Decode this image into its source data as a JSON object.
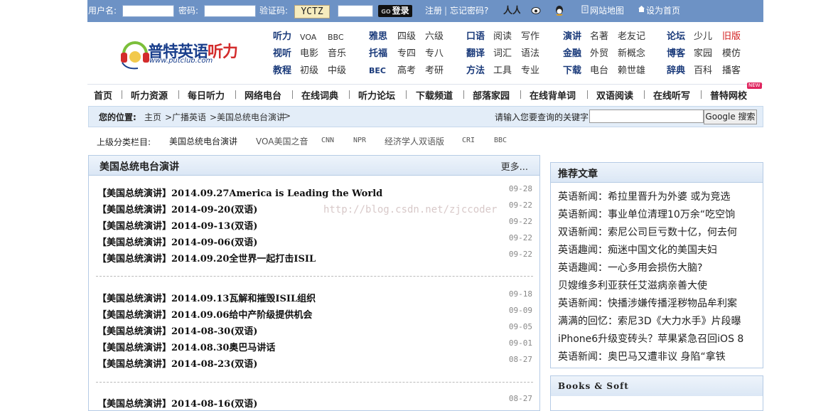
{
  "login": {
    "username_label": "用户名:",
    "password_label": "密码:",
    "captcha_label": "验证码:",
    "captcha_text": "YCTZ",
    "login_button": "登录",
    "login_key": "GO",
    "register": "注册",
    "forgot": "忘记密码?",
    "sitemap": "网站地图",
    "homepage": "设为首页"
  },
  "logo": {
    "name_part1": "普特英语",
    "name_part2": "听力",
    "url": "www.putclub.com"
  },
  "header_nav": [
    [
      "听力",
      "VOA",
      "BBC"
    ],
    [
      "视听",
      "电影",
      "音乐"
    ],
    [
      "教程",
      "初级",
      "中级"
    ],
    [
      "雅思",
      "四级",
      "六级"
    ],
    [
      "托福",
      "专四",
      "专八"
    ],
    [
      "BEC",
      "高考",
      "考研"
    ],
    [
      "口语",
      "阅读",
      "写作"
    ],
    [
      "翻译",
      "词汇",
      "语法"
    ],
    [
      "方法",
      "工具",
      "专业"
    ],
    [
      "演讲",
      "名著",
      "老友记"
    ],
    [
      "金融",
      "外贸",
      "新概念"
    ],
    [
      "下载",
      "电台",
      "赖世雄"
    ],
    [
      "论坛",
      "少儿",
      "旧版"
    ],
    [
      "博客",
      "家园",
      "模仿"
    ],
    [
      "辞典",
      "百科",
      "播客"
    ]
  ],
  "menu": [
    "首页",
    "听力资源",
    "每日听力",
    "网络电台",
    "在线词典",
    "听力论坛",
    "下载频道",
    "部落家园",
    "在线背单词",
    "双语阅读",
    "在线听写",
    "普特网校"
  ],
  "menu_badge": "NEW",
  "location": {
    "label": "您的位置:",
    "crumbs": [
      "主页",
      ">广播英语",
      ">美国总统电台演讲",
      ">"
    ],
    "search_prompt": "请输入您要查询的关键字",
    "search_button": "Google 搜索"
  },
  "categories": {
    "label": "上级分类栏目:",
    "items": [
      "美国总统电台演讲",
      "VOA美国之音",
      "CNN",
      "NPR",
      "经济学人双语版",
      "CRI",
      "BBC"
    ]
  },
  "list_panel": {
    "title": "美国总统电台演讲",
    "more": "更多...",
    "groups": [
      [
        {
          "title": "【美国总统演讲】2014.09.27America is Leading the World",
          "date": "09-28"
        },
        {
          "title": "【美国总统演讲】2014-09-20(双语)",
          "date": "09-22"
        },
        {
          "title": "【美国总统演讲】2014-09-13(双语)",
          "date": "09-22"
        },
        {
          "title": "【美国总统演讲】2014-09-06(双语)",
          "date": "09-22"
        },
        {
          "title": "【美国总统演讲】2014.09.20全世界一起打击ISIL",
          "date": "09-22"
        }
      ],
      [
        {
          "title": "【美国总统演讲】2014.09.13瓦解和摧毁ISIL组织",
          "date": "09-18"
        },
        {
          "title": "【美国总统演讲】2014.09.06给中产阶级提供机会",
          "date": "09-09"
        },
        {
          "title": "【美国总统演讲】2014-08-30(双语)",
          "date": "09-05"
        },
        {
          "title": "【美国总统演讲】2014.08.30奥巴马讲话",
          "date": "09-01"
        },
        {
          "title": "【美国总统演讲】2014-08-23(双语)",
          "date": "08-27"
        }
      ],
      [
        {
          "title": "【美国总统演讲】2014-08-16(双语)",
          "date": "08-27"
        }
      ]
    ]
  },
  "watermark": "http://blog.csdn.net/zjccoder",
  "recommend": {
    "title": "推荐文章",
    "items": [
      "英语新闻：希拉里晋升为外婆 或为竞选",
      "英语新闻：事业单位清理10万余“吃空饷",
      "双语新闻：索尼公司巨亏数十亿，何去何",
      "英语趣闻：痴迷中国文化的美国夫妇",
      "英语趣闻：一心多用会损伤大脑?",
      "贝嫂维多利亚获任艾滋病亲善大使",
      "英语新闻：快播涉嫌传播淫秽物品牟利案",
      "满满的回忆：索尼3D《大力水手》片段曝",
      "iPhone6升级变砖头？苹果紧急召回iOS 8",
      "英语新闻：奥巴马又遭非议 身陷“拿铁"
    ]
  },
  "books": {
    "title": "Books & Soft"
  }
}
